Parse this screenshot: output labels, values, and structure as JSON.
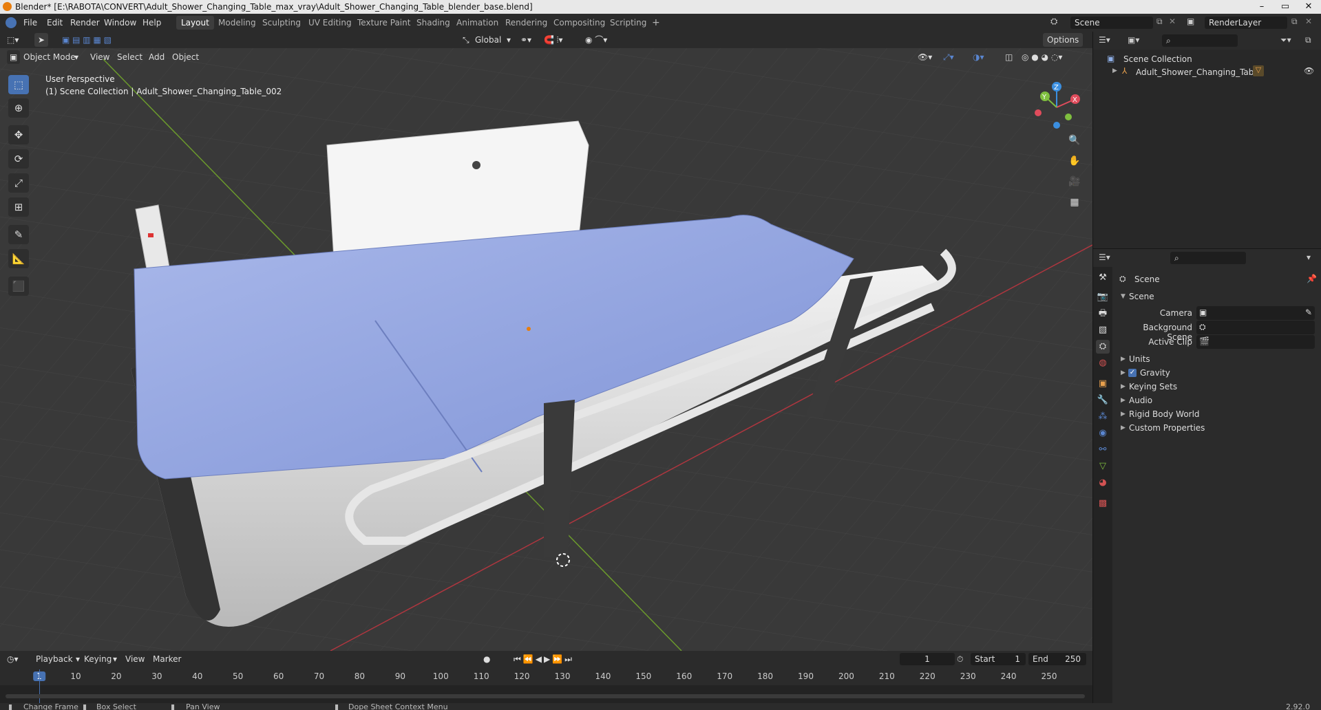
{
  "window": {
    "title": "Blender* [E:\\RABOTA\\CONVERT\\Adult_Shower_Changing_Table_max_vray\\Adult_Shower_Changing_Table_blender_base.blend]",
    "minimize": "–",
    "maximize": "▭",
    "close": "✕"
  },
  "menu": [
    "File",
    "Edit",
    "Render",
    "Window",
    "Help"
  ],
  "workspaces": [
    "Layout",
    "Modeling",
    "Sculpting",
    "UV Editing",
    "Texture Paint",
    "Shading",
    "Animation",
    "Rendering",
    "Compositing",
    "Scripting"
  ],
  "active_workspace": "Layout",
  "add_workspace": "+",
  "scene_field": "Scene",
  "renderlayer_field": "RenderLayer",
  "viewport_header": {
    "transform_orientation": "Global",
    "options": "Options",
    "mode": "Object Mode",
    "menus": [
      "View",
      "Select",
      "Add",
      "Object"
    ]
  },
  "viewport": {
    "perspective": "User Perspective",
    "collection_info": "(1) Scene Collection | Adult_Shower_Changing_Table_002",
    "gizmo": {
      "x": "X",
      "y": "Y",
      "z": "Z"
    }
  },
  "outliner": {
    "root": "Scene Collection",
    "items": [
      {
        "label": "Adult_Shower_Changing_Table"
      }
    ]
  },
  "properties": {
    "context": "Scene",
    "panel": "Scene",
    "fields": [
      {
        "label": "Camera"
      },
      {
        "label": "Background Scene"
      },
      {
        "label": "Active Clip"
      }
    ],
    "sections": [
      "Units",
      "Gravity",
      "Keying Sets",
      "Audio",
      "Rigid Body World",
      "Custom Properties"
    ]
  },
  "timeline": {
    "menus": [
      "Playback",
      "Keying",
      "View",
      "Marker"
    ],
    "current_frame": "1",
    "start_label": "Start",
    "start": "1",
    "end_label": "End",
    "end": "250",
    "frame_marks": [
      "1",
      "10",
      "20",
      "30",
      "40",
      "50",
      "60",
      "70",
      "80",
      "90",
      "100",
      "110",
      "120",
      "130",
      "140",
      "150",
      "160",
      "170",
      "180",
      "190",
      "200",
      "210",
      "220",
      "230",
      "240",
      "250"
    ]
  },
  "statusbar": [
    "Change Frame",
    "Box Select",
    "Pan View",
    "Dope Sheet Context Menu"
  ],
  "version": "2.92.0",
  "colors": {
    "accent": "#4772b3",
    "axis_x": "#e04c5c",
    "axis_y": "#7fbf3f",
    "axis_z": "#3b8fe0",
    "viewport_bg": "#393939"
  }
}
